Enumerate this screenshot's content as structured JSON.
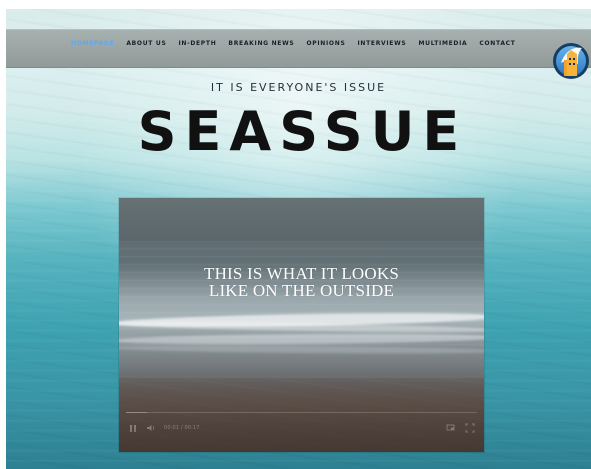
{
  "nav": {
    "items": [
      {
        "label": "HOMEPAGE",
        "active": true
      },
      {
        "label": "ABOUT US",
        "active": false
      },
      {
        "label": "IN-DEPTH",
        "active": false
      },
      {
        "label": "BREAKING NEWS",
        "active": false
      },
      {
        "label": "OPINIONS",
        "active": false
      },
      {
        "label": "INTERVIEWS",
        "active": false
      },
      {
        "label": "MULTIMEDIA",
        "active": false
      },
      {
        "label": "CONTACT",
        "active": false
      }
    ]
  },
  "hero": {
    "tagline": "IT IS EVERYONE'S ISSUE",
    "title": "SEASSUE"
  },
  "video": {
    "title_line_1": "THIS IS WHAT IT LOOKS",
    "title_line_2": "LIKE ON THE OUTSIDE",
    "time": "00:01 / 00:17",
    "progress_fraction": 0.06
  },
  "icons": {
    "logo": "logo-badge-icon",
    "pause": "pause-icon",
    "volume": "volume-icon",
    "pip": "picture-in-picture-icon",
    "fullscreen": "fullscreen-icon"
  },
  "colors": {
    "nav_active": "#5ea8f0",
    "headline": "#111111"
  }
}
